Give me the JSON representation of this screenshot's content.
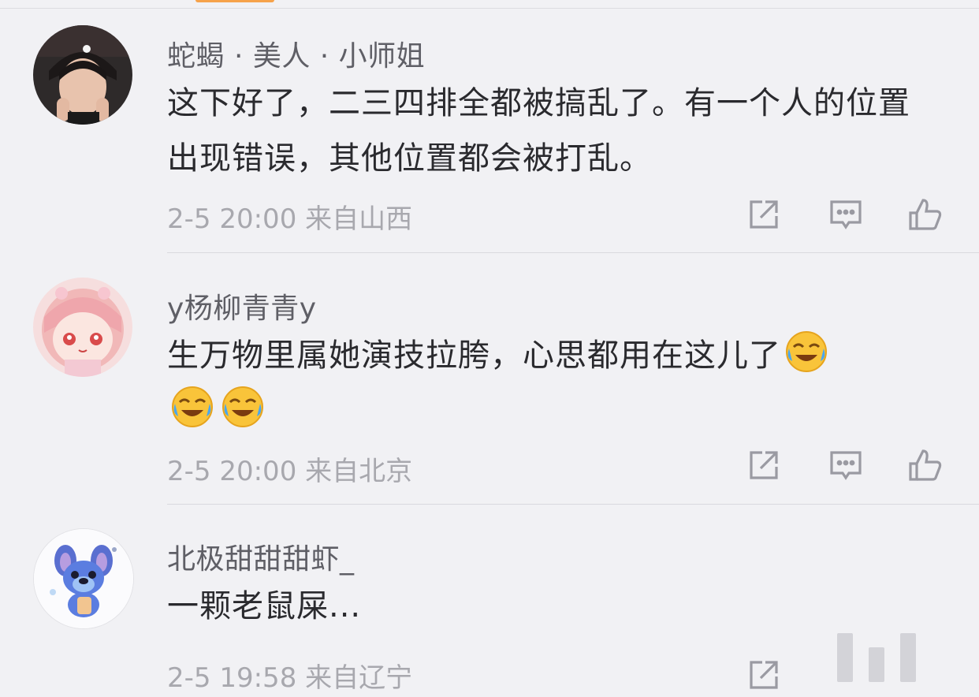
{
  "comments": [
    {
      "username": "蛇蝎 · 美人 · 小师姐",
      "text": "这下好了，二三四排全都被搞乱了。有一个人的位置出现错误，其他位置都会被打乱。",
      "meta": "2-5 20:00  来自山西"
    },
    {
      "username": "y杨柳青青y",
      "text": "生万物里属她演技拉胯，心思都用在这儿了",
      "emoji_count": 3,
      "emoji_name": "laughing-crying-emoji",
      "meta": "2-5 20:00  来自北京"
    },
    {
      "username": "北极甜甜甜虾_",
      "text": "一颗老鼠屎...",
      "meta": "2-5 19:58  来自辽宁"
    }
  ],
  "colors": {
    "background": "#f1f1f4",
    "username": "#5f5f66",
    "text": "#2a2a2e",
    "meta": "#a8a8ae",
    "icon": "#9a9aa2",
    "accent": "#f6a24a"
  },
  "icons": [
    "share-icon",
    "reply-icon",
    "like-icon"
  ]
}
